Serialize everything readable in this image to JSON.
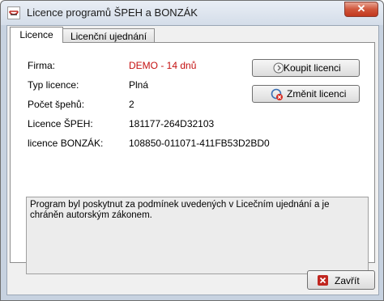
{
  "window": {
    "title": "Licence programů ŠPEH a BONZÁK"
  },
  "tabs": [
    {
      "label": "Licence",
      "active": true
    },
    {
      "label": "Licenční ujednání",
      "active": false
    }
  ],
  "fields": [
    {
      "label": "Firma:",
      "value": "DEMO - 14 dnů"
    },
    {
      "label": "Typ licence:",
      "value": "Plná"
    },
    {
      "label": "Počet špehů:",
      "value": "2"
    },
    {
      "label": "Licence ŠPEH:",
      "value": "181177-264D32103"
    },
    {
      "label": "licence BONZÁK:",
      "value": "108850-011071-411FB53D2BD0"
    }
  ],
  "buttons": {
    "buy": "Koupit licenci",
    "change": "Změnit licenci",
    "close": "Zavřít"
  },
  "notice": "Program byl poskytnut za podmínek uvedených v Licečním ujednání a je chráněn autorským zákonem.",
  "colors": {
    "demo_value": "#c41010",
    "close_icon": "#c0261f"
  },
  "icons": {
    "app": "app-logo-icon",
    "window_close": "close-icon",
    "buy": "circle-arrow-icon",
    "change": "refresh-error-icon",
    "close": "red-x-icon"
  }
}
